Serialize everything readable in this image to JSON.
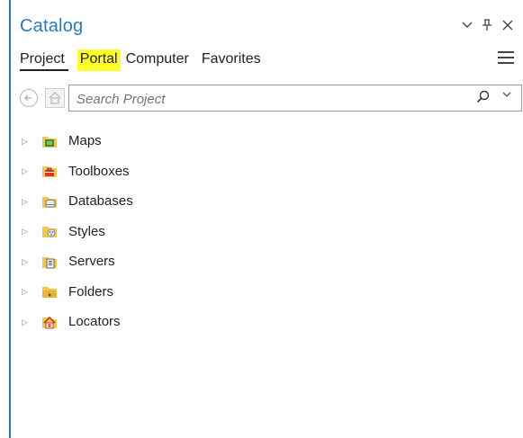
{
  "title": "Catalog",
  "title_controls": {
    "collapse": "⌄",
    "pin": "⊥",
    "close": "✕"
  },
  "tabs": [
    {
      "label": "Project",
      "state": "active"
    },
    {
      "label": "Portal",
      "state": "highlighted"
    },
    {
      "label": "Computer",
      "state": "normal"
    },
    {
      "label": "Favorites",
      "state": "normal"
    }
  ],
  "search": {
    "placeholder": "Search Project",
    "value": ""
  },
  "tree": [
    {
      "label": "Maps",
      "icon": "maps-folder-icon",
      "color": "#3d8b3d"
    },
    {
      "label": "Toolboxes",
      "icon": "toolbox-folder-icon",
      "color": "#d13a2b"
    },
    {
      "label": "Databases",
      "icon": "database-folder-icon",
      "color": "#6c7a8a"
    },
    {
      "label": "Styles",
      "icon": "styles-folder-icon",
      "color": "#8a8f99"
    },
    {
      "label": "Servers",
      "icon": "servers-folder-icon",
      "color": "#5b6068"
    },
    {
      "label": "Folders",
      "icon": "folders-folder-icon",
      "color": "#d6a93a"
    },
    {
      "label": "Locators",
      "icon": "locators-folder-icon",
      "color": "#c9342a"
    }
  ],
  "colors": {
    "accent_title": "#2a7bbf",
    "highlight": "#ffff2a",
    "folder_yellow": "#f2c84b"
  }
}
